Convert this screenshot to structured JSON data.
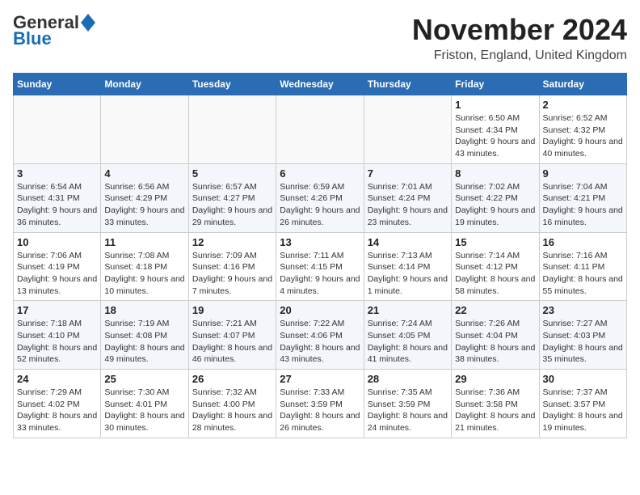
{
  "header": {
    "logo_general": "General",
    "logo_blue": "Blue",
    "title": "November 2024",
    "subtitle": "Friston, England, United Kingdom"
  },
  "weekdays": [
    "Sunday",
    "Monday",
    "Tuesday",
    "Wednesday",
    "Thursday",
    "Friday",
    "Saturday"
  ],
  "weeks": [
    [
      {
        "day": "",
        "info": ""
      },
      {
        "day": "",
        "info": ""
      },
      {
        "day": "",
        "info": ""
      },
      {
        "day": "",
        "info": ""
      },
      {
        "day": "",
        "info": ""
      },
      {
        "day": "1",
        "info": "Sunrise: 6:50 AM\nSunset: 4:34 PM\nDaylight: 9 hours\nand 43 minutes."
      },
      {
        "day": "2",
        "info": "Sunrise: 6:52 AM\nSunset: 4:32 PM\nDaylight: 9 hours\nand 40 minutes."
      }
    ],
    [
      {
        "day": "3",
        "info": "Sunrise: 6:54 AM\nSunset: 4:31 PM\nDaylight: 9 hours\nand 36 minutes."
      },
      {
        "day": "4",
        "info": "Sunrise: 6:56 AM\nSunset: 4:29 PM\nDaylight: 9 hours\nand 33 minutes."
      },
      {
        "day": "5",
        "info": "Sunrise: 6:57 AM\nSunset: 4:27 PM\nDaylight: 9 hours\nand 29 minutes."
      },
      {
        "day": "6",
        "info": "Sunrise: 6:59 AM\nSunset: 4:26 PM\nDaylight: 9 hours\nand 26 minutes."
      },
      {
        "day": "7",
        "info": "Sunrise: 7:01 AM\nSunset: 4:24 PM\nDaylight: 9 hours\nand 23 minutes."
      },
      {
        "day": "8",
        "info": "Sunrise: 7:02 AM\nSunset: 4:22 PM\nDaylight: 9 hours\nand 19 minutes."
      },
      {
        "day": "9",
        "info": "Sunrise: 7:04 AM\nSunset: 4:21 PM\nDaylight: 9 hours\nand 16 minutes."
      }
    ],
    [
      {
        "day": "10",
        "info": "Sunrise: 7:06 AM\nSunset: 4:19 PM\nDaylight: 9 hours\nand 13 minutes."
      },
      {
        "day": "11",
        "info": "Sunrise: 7:08 AM\nSunset: 4:18 PM\nDaylight: 9 hours\nand 10 minutes."
      },
      {
        "day": "12",
        "info": "Sunrise: 7:09 AM\nSunset: 4:16 PM\nDaylight: 9 hours\nand 7 minutes."
      },
      {
        "day": "13",
        "info": "Sunrise: 7:11 AM\nSunset: 4:15 PM\nDaylight: 9 hours\nand 4 minutes."
      },
      {
        "day": "14",
        "info": "Sunrise: 7:13 AM\nSunset: 4:14 PM\nDaylight: 9 hours\nand 1 minute."
      },
      {
        "day": "15",
        "info": "Sunrise: 7:14 AM\nSunset: 4:12 PM\nDaylight: 8 hours\nand 58 minutes."
      },
      {
        "day": "16",
        "info": "Sunrise: 7:16 AM\nSunset: 4:11 PM\nDaylight: 8 hours\nand 55 minutes."
      }
    ],
    [
      {
        "day": "17",
        "info": "Sunrise: 7:18 AM\nSunset: 4:10 PM\nDaylight: 8 hours\nand 52 minutes."
      },
      {
        "day": "18",
        "info": "Sunrise: 7:19 AM\nSunset: 4:08 PM\nDaylight: 8 hours\nand 49 minutes."
      },
      {
        "day": "19",
        "info": "Sunrise: 7:21 AM\nSunset: 4:07 PM\nDaylight: 8 hours\nand 46 minutes."
      },
      {
        "day": "20",
        "info": "Sunrise: 7:22 AM\nSunset: 4:06 PM\nDaylight: 8 hours\nand 43 minutes."
      },
      {
        "day": "21",
        "info": "Sunrise: 7:24 AM\nSunset: 4:05 PM\nDaylight: 8 hours\nand 41 minutes."
      },
      {
        "day": "22",
        "info": "Sunrise: 7:26 AM\nSunset: 4:04 PM\nDaylight: 8 hours\nand 38 minutes."
      },
      {
        "day": "23",
        "info": "Sunrise: 7:27 AM\nSunset: 4:03 PM\nDaylight: 8 hours\nand 35 minutes."
      }
    ],
    [
      {
        "day": "24",
        "info": "Sunrise: 7:29 AM\nSunset: 4:02 PM\nDaylight: 8 hours\nand 33 minutes."
      },
      {
        "day": "25",
        "info": "Sunrise: 7:30 AM\nSunset: 4:01 PM\nDaylight: 8 hours\nand 30 minutes."
      },
      {
        "day": "26",
        "info": "Sunrise: 7:32 AM\nSunset: 4:00 PM\nDaylight: 8 hours\nand 28 minutes."
      },
      {
        "day": "27",
        "info": "Sunrise: 7:33 AM\nSunset: 3:59 PM\nDaylight: 8 hours\nand 26 minutes."
      },
      {
        "day": "28",
        "info": "Sunrise: 7:35 AM\nSunset: 3:59 PM\nDaylight: 8 hours\nand 24 minutes."
      },
      {
        "day": "29",
        "info": "Sunrise: 7:36 AM\nSunset: 3:58 PM\nDaylight: 8 hours\nand 21 minutes."
      },
      {
        "day": "30",
        "info": "Sunrise: 7:37 AM\nSunset: 3:57 PM\nDaylight: 8 hours\nand 19 minutes."
      }
    ]
  ]
}
